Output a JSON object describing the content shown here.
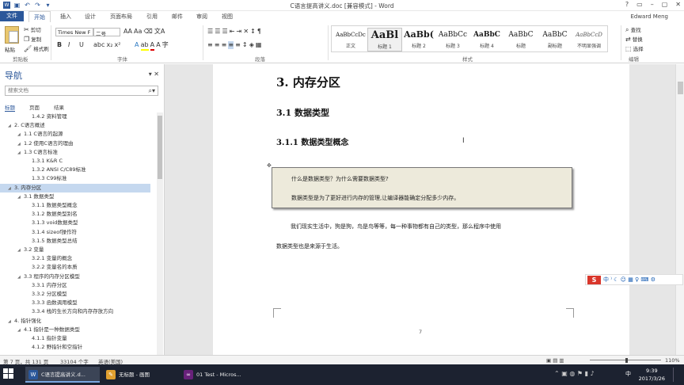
{
  "window": {
    "title": "C语言提高讲义.doc [兼容模式] - Word",
    "user": "Edward Meng",
    "controls": [
      "?",
      "▭",
      "–",
      "▢",
      "✕"
    ]
  },
  "tabs": [
    {
      "label": "文件"
    },
    {
      "label": "开始"
    },
    {
      "label": "插入"
    },
    {
      "label": "设计"
    },
    {
      "label": "页面布局"
    },
    {
      "label": "引用"
    },
    {
      "label": "邮件"
    },
    {
      "label": "审阅"
    },
    {
      "label": "视图"
    }
  ],
  "ribbon": {
    "clipboard": {
      "paste": "粘贴",
      "cut": "剪切",
      "copy": "复制",
      "format_painter": "格式刷",
      "group": "剪贴板"
    },
    "font": {
      "name": "Times New F",
      "size": "二号",
      "group": "字体"
    },
    "paragraph": {
      "group": "段落"
    },
    "styles": {
      "group": "样式",
      "items": [
        {
          "preview": "AaBbCcDc",
          "name": "正文"
        },
        {
          "preview": "AaBl",
          "name": "标题 1"
        },
        {
          "preview": "AaBb(",
          "name": "标题 2"
        },
        {
          "preview": "AaBbCc",
          "name": "标题 3"
        },
        {
          "preview": "AaBbC",
          "name": "标题 4"
        },
        {
          "preview": "AaBbC",
          "name": "标题"
        },
        {
          "preview": "AaBbC",
          "name": "副标题"
        },
        {
          "preview": "AaBbCcD",
          "name": "不明显强调"
        }
      ]
    },
    "editing": {
      "find": "查找",
      "replace": "替换",
      "select": "选择",
      "group": "编辑"
    }
  },
  "navigation": {
    "title": "导航",
    "search_placeholder": "搜索文档",
    "tabs": [
      {
        "label": "标题"
      },
      {
        "label": "页面"
      },
      {
        "label": "结果"
      }
    ],
    "items": [
      {
        "label": "1.4.2 资料管理",
        "level": 3
      },
      {
        "label": "2. C语言概述",
        "level": 1
      },
      {
        "label": "1.1 C语言的起源",
        "level": 2
      },
      {
        "label": "1.2 使用C语言的理由",
        "level": 2
      },
      {
        "label": "1.3 C语言标准",
        "level": 2
      },
      {
        "label": "1.3.1 K&R C",
        "level": 3
      },
      {
        "label": "1.3.2 ANSI C/C89标准",
        "level": 3
      },
      {
        "label": "1.3.3 C99标准",
        "level": 3
      },
      {
        "label": "3. 内存分区",
        "level": 1,
        "selected": true
      },
      {
        "label": "3.1 数据类型",
        "level": 2
      },
      {
        "label": "3.1.1 数据类型概念",
        "level": 3
      },
      {
        "label": "3.1.2 数据类型别名",
        "level": 3
      },
      {
        "label": "3.1.3 void数据类型",
        "level": 3
      },
      {
        "label": "3.1.4 sizeof操作符",
        "level": 3
      },
      {
        "label": "3.1.5 数据类型总结",
        "level": 3
      },
      {
        "label": "3.2 变量",
        "level": 2
      },
      {
        "label": "3.2.1 变量的概念",
        "level": 3
      },
      {
        "label": "3.2.2 变量名的本质",
        "level": 3
      },
      {
        "label": "3.3 程序的内存分区模型",
        "level": 2
      },
      {
        "label": "3.3.1 内存分区",
        "level": 3
      },
      {
        "label": "3.3.2 分区模型",
        "level": 3
      },
      {
        "label": "3.3.3 函数调用模型",
        "level": 3
      },
      {
        "label": "3.3.4 栈的生长方向和内存存放方向",
        "level": 3
      },
      {
        "label": "4. 指针强化",
        "level": 1
      },
      {
        "label": "4.1 指针是一种数据类型",
        "level": 2
      },
      {
        "label": "4.1.1 指针变量",
        "level": 3
      },
      {
        "label": "4.1.2 野指针和空指针",
        "level": 3
      }
    ]
  },
  "document": {
    "h1": "3.  内存分区",
    "h2": "3.1  数据类型",
    "h3": "3.1.1  数据类型概念",
    "box_q": "什么是数据类型？为什么需要数据类型?",
    "box_a": "数据类型是为了更好进行内存的管理,让编译器能确定分配多少内存。",
    "para1": "我们现实生活中，狗是狗，鸟是鸟等等，每一种事物都有自己的类型，那么程序中使用",
    "para2": "数据类型也是来源于生活。",
    "page_number": "7"
  },
  "status": {
    "page": "第 7 页，共 131 页",
    "words": "33104 个字",
    "lang": "英语(美国)",
    "zoom": "110%"
  },
  "taskbar": {
    "items": [
      {
        "label": "C语言提高讲义.d...",
        "icon": "W",
        "color": "#2b579a",
        "active": true
      },
      {
        "label": "无标题 - 画图",
        "icon": "✎",
        "color": "#e0a030",
        "active": false
      },
      {
        "label": "01 Test - Micros...",
        "icon": "∞",
        "color": "#68217a",
        "active": false
      }
    ],
    "time": "9:39",
    "date": "2017/3/26",
    "ime_lang": "中"
  },
  "ime": {
    "logo": "S",
    "text": "中 ⁾ ☾ ☺ ▦ ♀ ⌨ ⚙"
  }
}
